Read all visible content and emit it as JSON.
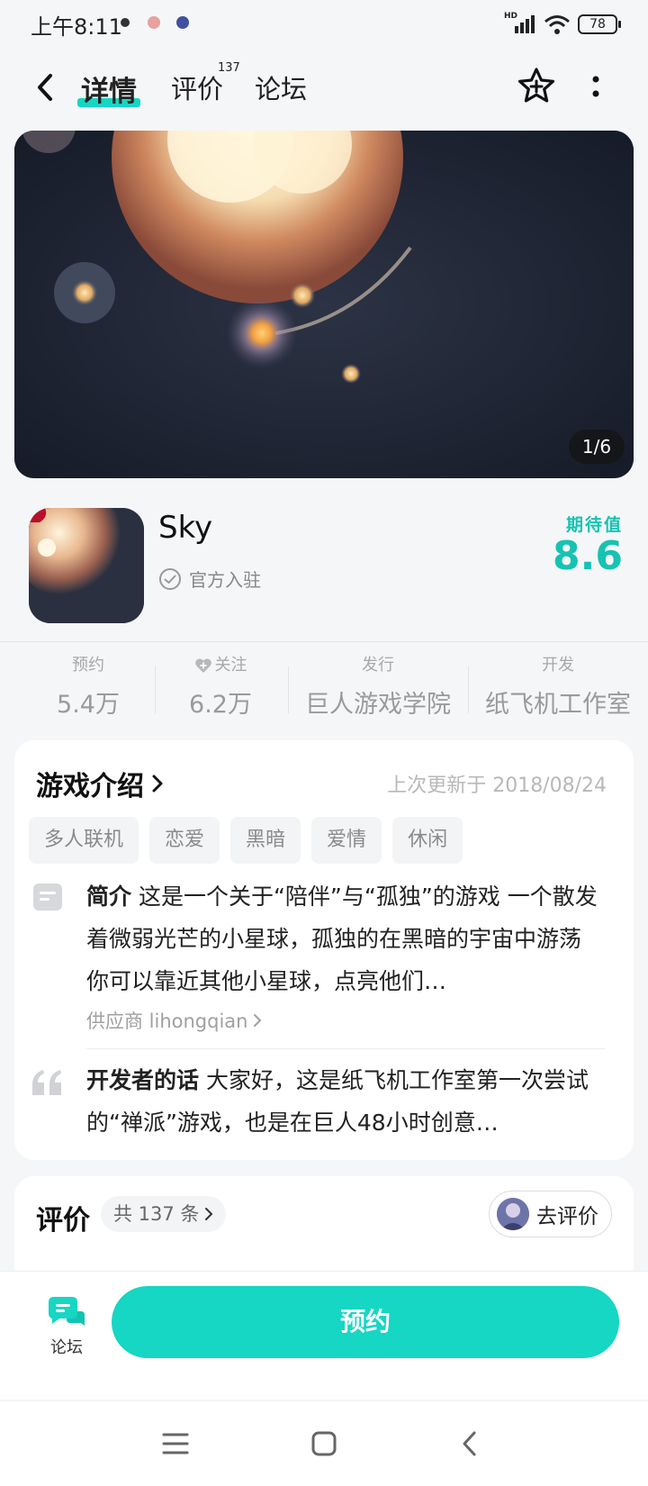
{
  "status_bar": {
    "time": "上午8:11",
    "battery": "78",
    "colors": {
      "dot1": "#e85a40",
      "dot2": "#c8a0d0",
      "dot3": "#4050a0"
    }
  },
  "nav": {
    "tab_details": "详情",
    "tab_reviews": "评价",
    "tab_reviews_badge": "137",
    "tab_forum": "论坛"
  },
  "hero": {
    "indicator": "1/6"
  },
  "app": {
    "name": "Sky",
    "verified_label": "官方入驻",
    "expectation_label": "期待值",
    "expectation_value": "8.6"
  },
  "stats": [
    {
      "label": "预约",
      "value": "5.4万"
    },
    {
      "label": "关注",
      "value": "6.2万"
    },
    {
      "label": "发行",
      "value": "巨人游戏学院"
    },
    {
      "label": "开发",
      "value": "纸飞机工作室"
    }
  ],
  "intro": {
    "title": "游戏介绍",
    "updated": "上次更新于 2018/08/24",
    "tags": [
      "多人联机",
      "恋爱",
      "黑暗",
      "爱情",
      "休闲"
    ],
    "summary_label": "简介",
    "summary_text": " 这是一个关于“陪伴”与“孤独”的游戏 一个散发着微弱光芒的小星球，孤独的在黑暗的宇宙中游荡 你可以靠近其他小星球，点亮他们…",
    "provider": "供应商 lihongqian",
    "dev_label": "开发者的话",
    "dev_text": " 大家好，这是纸飞机工作室第一次尝试的“禅派”游戏，也是在巨人48小时创意…"
  },
  "reviews": {
    "title": "评价",
    "count": "共 137 条",
    "go_review": "去评价"
  },
  "bottom": {
    "forum_label": "论坛",
    "reserve_label": "预约"
  },
  "theme": {
    "accent": "#16d6c4",
    "accent_text": "#16c3b2"
  }
}
